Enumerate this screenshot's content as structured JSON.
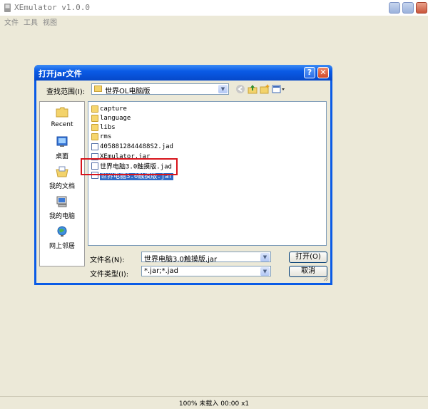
{
  "window": {
    "title": "XEmulator v1.0.0",
    "menu": [
      "文件",
      "工具",
      "视图"
    ]
  },
  "status": {
    "text": "100% 未载入 00:00 x1"
  },
  "dialog": {
    "title": "打开jar文件",
    "help_label": "?",
    "close_label": "✕",
    "look_in_label": "查找范围(I):",
    "look_in_value": "世界OL电脑版",
    "places": [
      {
        "label": "Recent",
        "icon": "recent-folder-icon"
      },
      {
        "label": "桌面",
        "icon": "desktop-icon"
      },
      {
        "label": "我的文档",
        "icon": "my-documents-icon"
      },
      {
        "label": "我的电脑",
        "icon": "my-computer-icon"
      },
      {
        "label": "网上邻居",
        "icon": "network-places-icon"
      }
    ],
    "files": [
      {
        "name": "capture",
        "type": "folder"
      },
      {
        "name": "language",
        "type": "folder"
      },
      {
        "name": "libs",
        "type": "folder"
      },
      {
        "name": "rms",
        "type": "folder"
      },
      {
        "name": "4058812844488S2.jad",
        "type": "file"
      },
      {
        "name": "XEmulator.jar",
        "type": "file"
      },
      {
        "name": "世界电脑3.0触摸版.jad",
        "type": "file"
      },
      {
        "name": "世界电脑3.0触摸版.jar",
        "type": "file",
        "selected": true
      }
    ],
    "filename_label": "文件名(N):",
    "filename_value": "世界电脑3.0触摸版.jar",
    "filetype_label": "文件类型(I):",
    "filetype_value": "*.jar;*.jad",
    "open_label": "打开(O)",
    "cancel_label": "取消"
  },
  "colors": {
    "selection": "#316ac5",
    "highlight_box": "#d8141b",
    "title_blue": "#0a5be6"
  }
}
